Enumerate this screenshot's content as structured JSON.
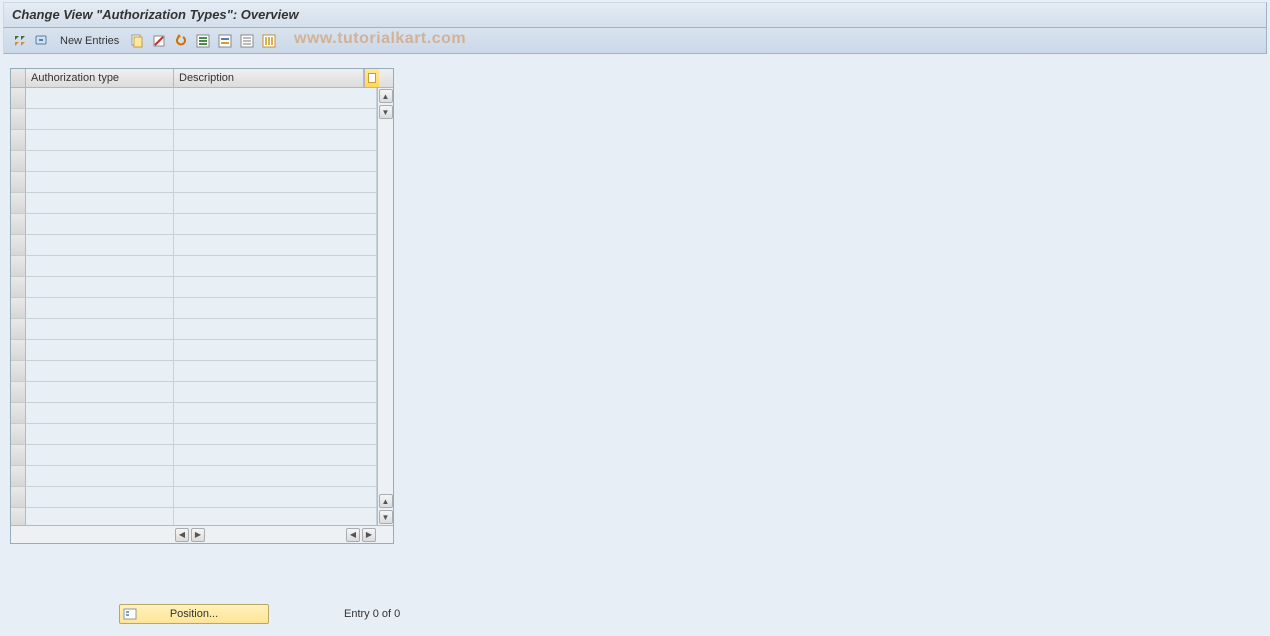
{
  "title": "Change View \"Authorization Types\": Overview",
  "toolbar": {
    "new_entries_label": "New Entries"
  },
  "watermark": "www.tutorialkart.com",
  "table": {
    "columns": {
      "auth_type": "Authorization type",
      "description": "Description"
    },
    "rows": [
      {
        "auth_type": "",
        "description": ""
      },
      {
        "auth_type": "",
        "description": ""
      },
      {
        "auth_type": "",
        "description": ""
      },
      {
        "auth_type": "",
        "description": ""
      },
      {
        "auth_type": "",
        "description": ""
      },
      {
        "auth_type": "",
        "description": ""
      },
      {
        "auth_type": "",
        "description": ""
      },
      {
        "auth_type": "",
        "description": ""
      },
      {
        "auth_type": "",
        "description": ""
      },
      {
        "auth_type": "",
        "description": ""
      },
      {
        "auth_type": "",
        "description": ""
      },
      {
        "auth_type": "",
        "description": ""
      },
      {
        "auth_type": "",
        "description": ""
      },
      {
        "auth_type": "",
        "description": ""
      },
      {
        "auth_type": "",
        "description": ""
      },
      {
        "auth_type": "",
        "description": ""
      },
      {
        "auth_type": "",
        "description": ""
      },
      {
        "auth_type": "",
        "description": ""
      },
      {
        "auth_type": "",
        "description": ""
      },
      {
        "auth_type": "",
        "description": ""
      },
      {
        "auth_type": "",
        "description": ""
      }
    ]
  },
  "footer": {
    "position_label": "Position...",
    "entry_status": "Entry 0 of 0"
  }
}
